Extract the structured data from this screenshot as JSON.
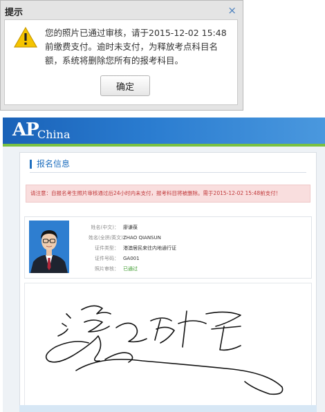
{
  "dialog": {
    "title": "提示",
    "close_symbol": "×",
    "message": "您的照片已通过审核，请于2015-12-02 15:48前缴费支付。逾时未支付，为释放考点科目名额，系统将删除您所有的报考科目。",
    "ok_label": "确定",
    "icon": "warning-icon"
  },
  "page": {
    "logo_main": "AP",
    "logo_sub": "China",
    "section_title": "报名信息",
    "notice": "请注意：自报名考生照片审核通过后24小时内未支付，报考科目将被删除。需于2015-12-02 15:48前支付！",
    "fields": [
      {
        "label": "姓名(中文)：",
        "value": "廖谦葆"
      },
      {
        "label": "姓名(全拼/英文)：",
        "value": "ZHAO QIANSUN"
      },
      {
        "label": "证件类型：",
        "value": "港澳居民来往内地通行证"
      },
      {
        "label": "证件号码：",
        "value": "GA001"
      },
      {
        "label": "照片审核：",
        "value": "已通过"
      }
    ]
  },
  "colors": {
    "header_blue": "#1a62b8",
    "accent_green": "#79c142",
    "notice_red": "#c0393b",
    "approved_green": "#3a9a2a"
  }
}
